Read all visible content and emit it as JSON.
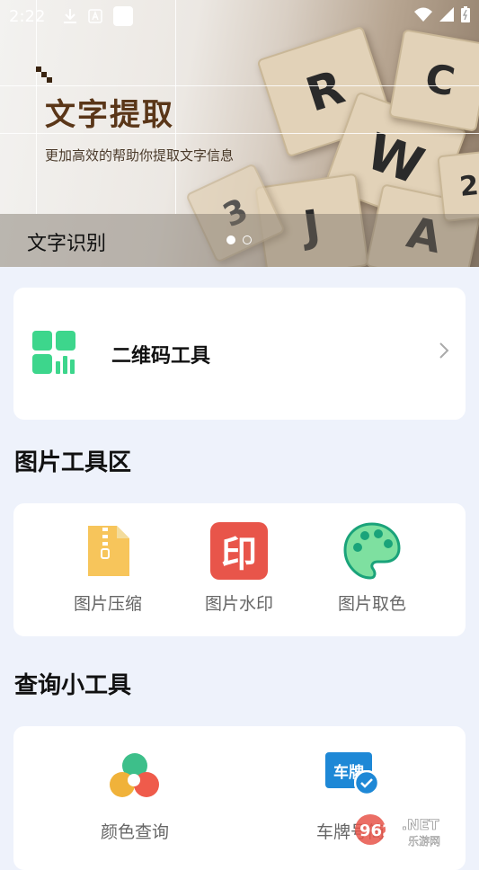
{
  "status_bar": {
    "time": "2:22"
  },
  "banner": {
    "title": "文字提取",
    "subtitle": "更加高效的帮助你提取文字信息",
    "caption": "文字识别",
    "tile_letters": [
      "R",
      "W",
      "J",
      "A",
      "C",
      "3",
      "2"
    ]
  },
  "qr_tool": {
    "label": "二维码工具"
  },
  "image_tools": {
    "title": "图片工具区",
    "items": [
      {
        "label": "图片压缩",
        "icon": "zip-file-icon"
      },
      {
        "label": "图片水印",
        "icon": "watermark-stamp-icon",
        "glyph": "印"
      },
      {
        "label": "图片取色",
        "icon": "palette-icon"
      }
    ]
  },
  "query_tools": {
    "title": "查询小工具",
    "items": [
      {
        "label": "颜色查询",
        "icon": "color-circles-icon"
      },
      {
        "label": "车牌号简",
        "icon": "license-plate-icon",
        "glyph": "车牌"
      }
    ]
  },
  "watermark": {
    "brand": "962",
    "suffix": ".NET",
    "sub": "乐游网"
  },
  "colors": {
    "background": "#eef2fb",
    "qr_green": "#3dd68c",
    "watermark_red": "#e8554a",
    "zip_yellow": "#f7c55b",
    "plate_blue": "#1e88d6"
  }
}
